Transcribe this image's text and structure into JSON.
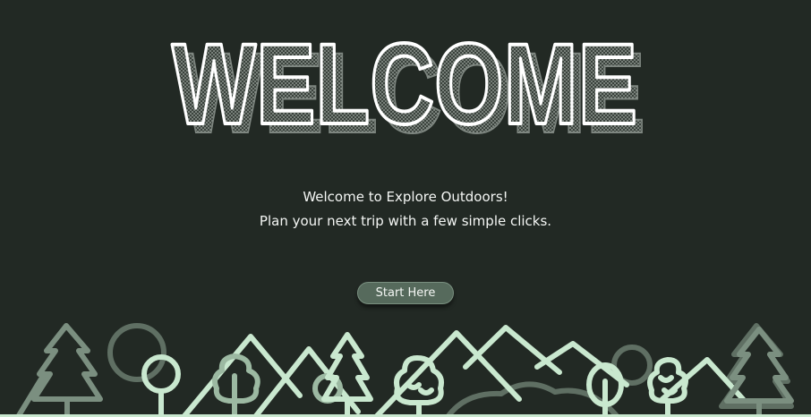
{
  "hero": {
    "title": "WELCOME"
  },
  "intro": {
    "line1": "Welcome to Explore Outdoors!",
    "line2": "Plan your next trip with a few simple clicks."
  },
  "actions": {
    "start_label": "Start Here"
  },
  "colors": {
    "background": "#222924",
    "title_fill": "#ffffff",
    "title_shadow": "#8e9690",
    "button": "#566a5c",
    "landscape_light": "#c9e8cf",
    "landscape_muted": "#7b8f80"
  },
  "icons": [
    "tree-icon",
    "mountain-icon"
  ]
}
